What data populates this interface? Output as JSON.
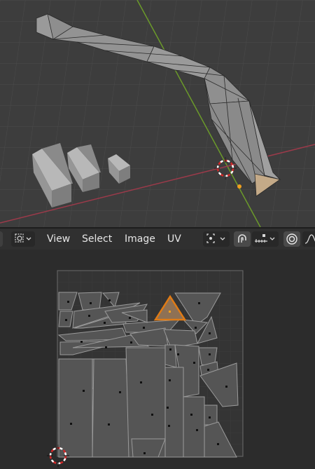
{
  "header": {
    "menus": [
      "View",
      "Select",
      "Image",
      "UV"
    ]
  },
  "icons": {
    "editor_type": "uv-editor-icon",
    "select_mode": "sync-selection-icon",
    "pivot": "pivot-point-icon",
    "snap": "snap-magnet-icon",
    "snap_target": "snap-increment-icon",
    "proportional": "proportional-editing-icon",
    "falloff": "falloff-curve-icon"
  },
  "colors": {
    "viewport_bg": "#3d3d3d",
    "uv_bg": "#2c2c2c",
    "selected_face": "#e07b15",
    "x_axis": "#9c3a4a",
    "y_axis": "#6b9a2a"
  }
}
